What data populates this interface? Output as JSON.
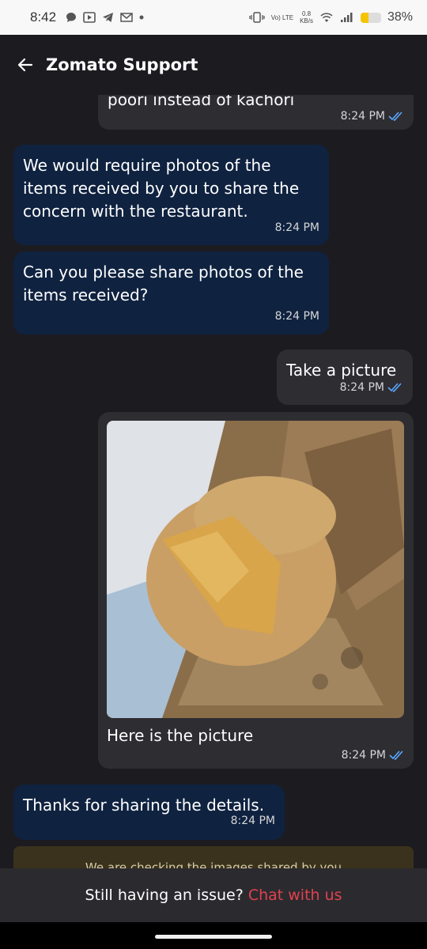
{
  "status_bar": {
    "time": "8:42",
    "netspeed_value": "0.8",
    "netspeed_unit": "KB/s",
    "network": "Vo) LTE",
    "battery": "38%",
    "battery_level": 0.38
  },
  "header": {
    "title": "Zomato Support"
  },
  "messages": [
    {
      "from": "user",
      "text": "poori instead of kachori",
      "time": "8:24 PM"
    },
    {
      "from": "agent",
      "text": "We would require photos of the items received by you to share the concern with the restaurant.",
      "time": "8:24 PM"
    },
    {
      "from": "agent",
      "text": "Can you please share photos of the items received?",
      "time": "8:24 PM"
    },
    {
      "from": "user",
      "text": "Take a picture",
      "time": "8:24 PM"
    },
    {
      "from": "user",
      "caption": "Here is the picture",
      "time": "8:24 PM"
    },
    {
      "from": "agent",
      "text": "Thanks for sharing the details.",
      "time": "8:24 PM"
    }
  ],
  "notice": {
    "text": "We are checking the images shared by you"
  },
  "bottom": {
    "question": "Still having an issue?",
    "link": "Chat with us"
  },
  "colors": {
    "background": "#1c1b20",
    "user_bubble": "#2e2d32",
    "agent_bubble": "#0f2240",
    "read_tick": "#5aa8ff",
    "link": "#e0424f"
  }
}
